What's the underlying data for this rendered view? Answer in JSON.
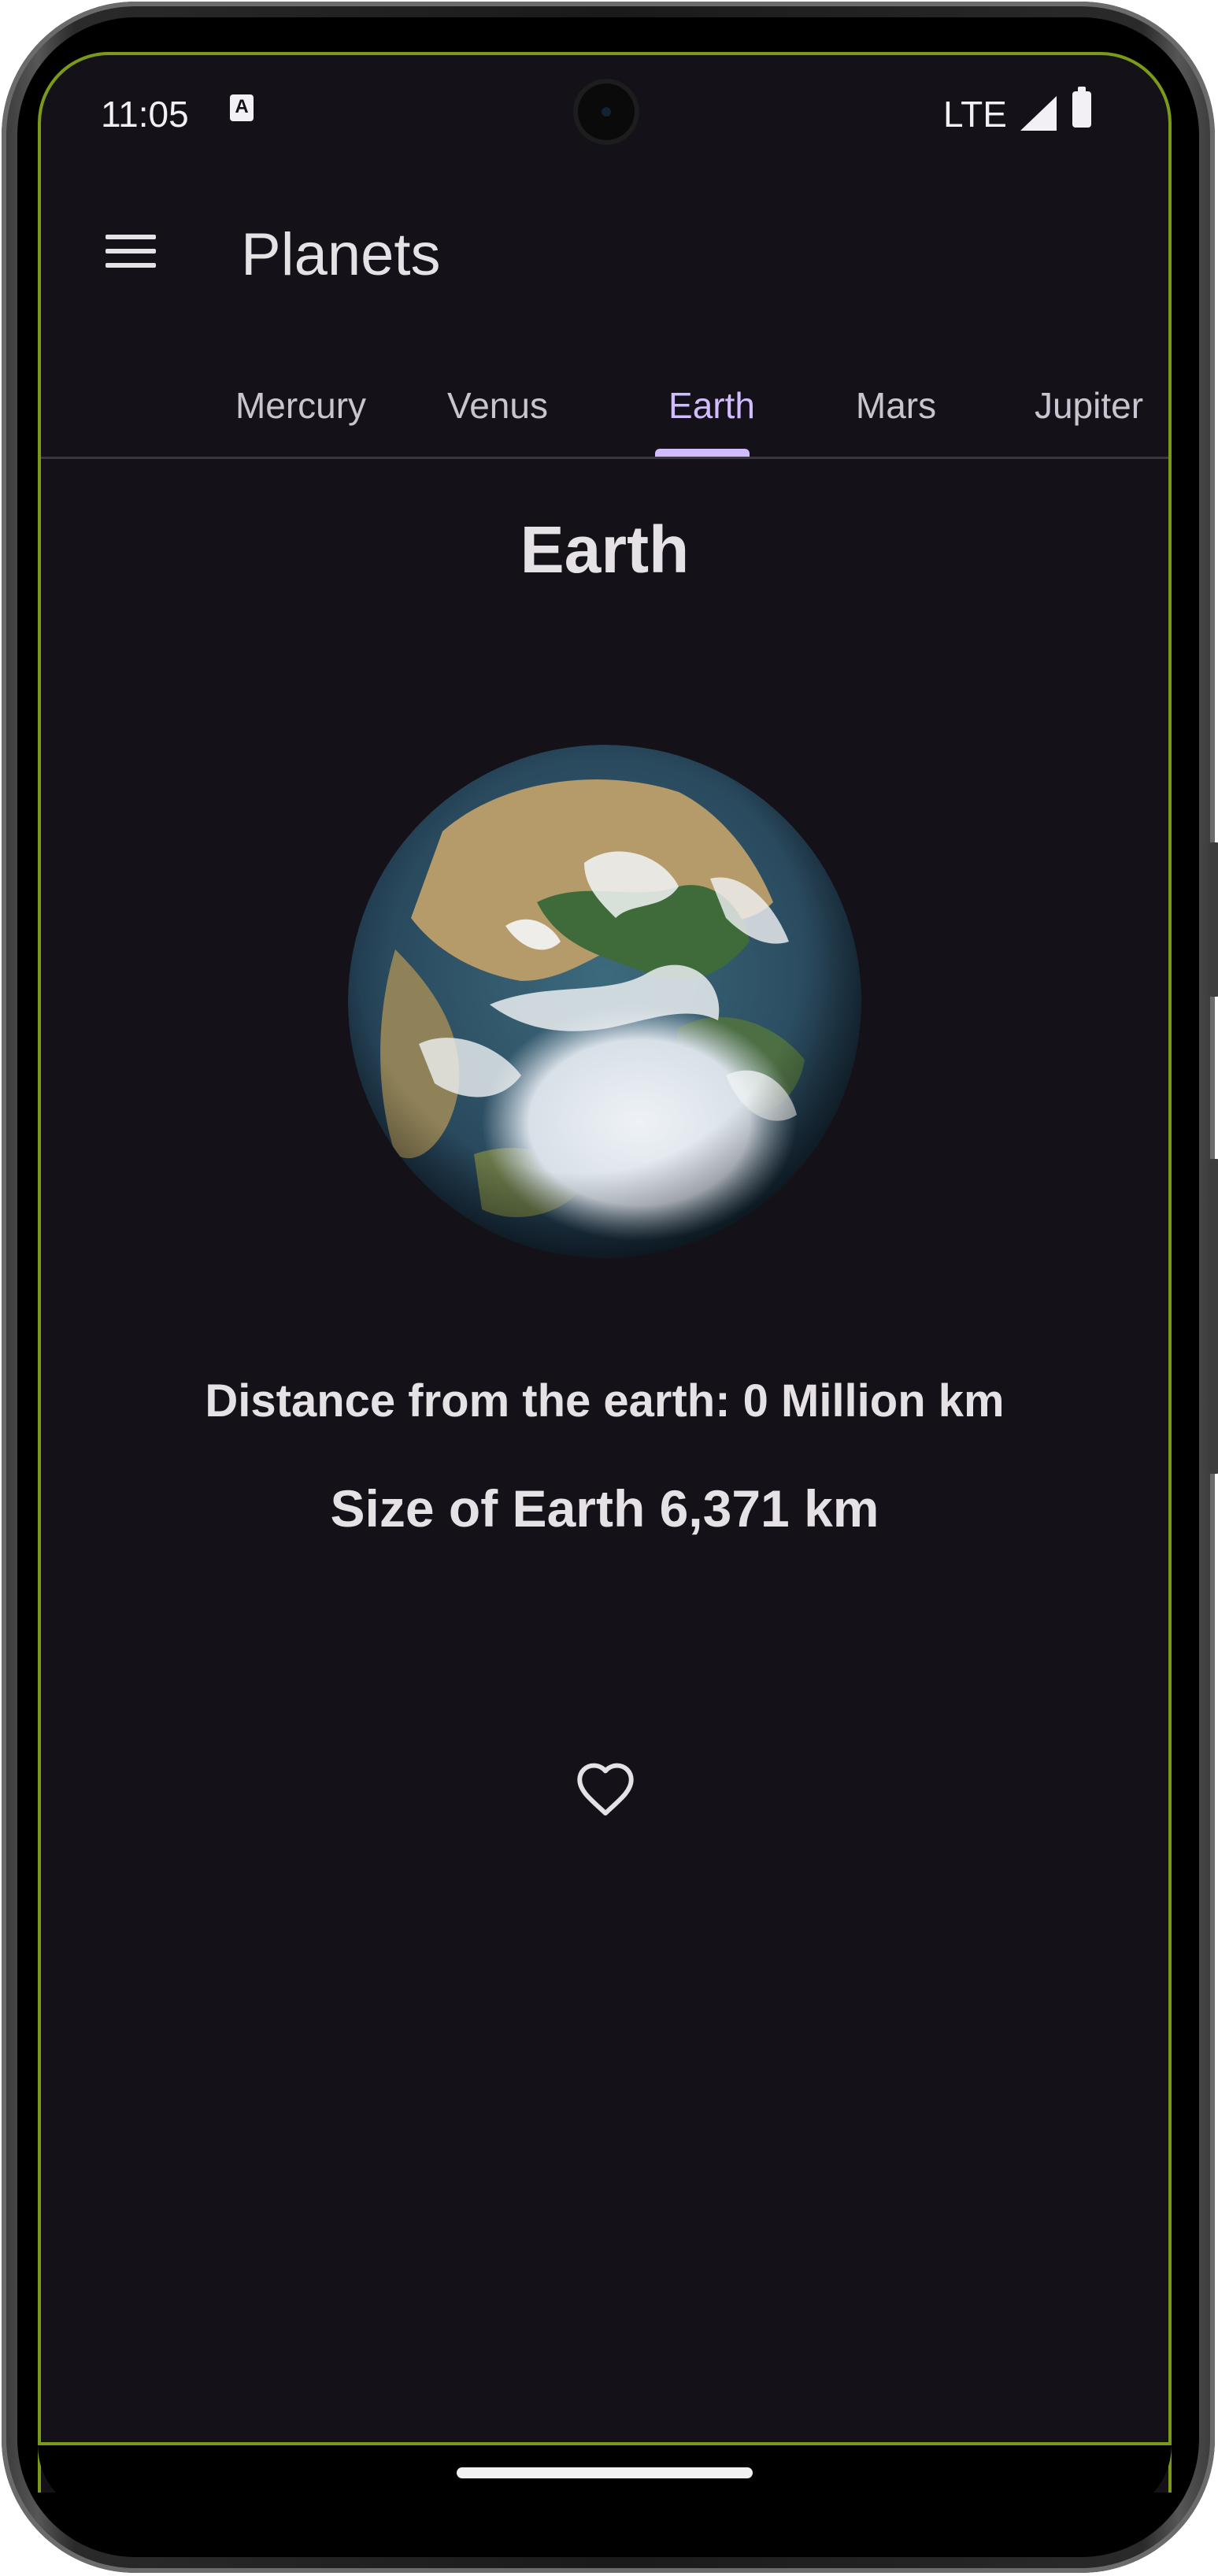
{
  "status_bar": {
    "time": "11:05",
    "keyboard_badge": "A",
    "network": "LTE",
    "icons": [
      "signal-icon",
      "battery-icon"
    ]
  },
  "app_bar": {
    "title": "Planets",
    "menu_icon": "menu-icon"
  },
  "tabs": {
    "items": [
      {
        "label": "Mercury"
      },
      {
        "label": "Venus"
      },
      {
        "label": "Earth"
      },
      {
        "label": "Mars"
      },
      {
        "label": "Jupiter"
      }
    ],
    "selected": "Earth"
  },
  "planet": {
    "name": "Earth",
    "image_icon": "earth-globe",
    "distance_text": "Distance from the earth: 0 Million km",
    "size_text": "Size of Earth 6,371 km"
  },
  "actions": {
    "favorite_icon": "heart-outline-icon"
  },
  "colors": {
    "background": "#141218",
    "text": "#e6e1e5",
    "accent": "#d0bcff",
    "inactive_tab": "#cac4d0"
  }
}
